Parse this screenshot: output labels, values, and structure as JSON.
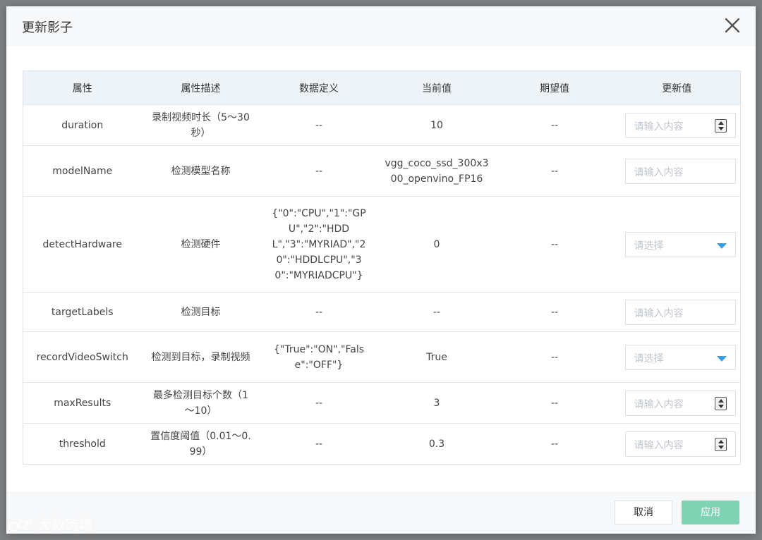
{
  "dialog": {
    "title": "更新影子",
    "cancel_label": "取消",
    "apply_label": "应用"
  },
  "table": {
    "headers": [
      "属性",
      "属性描述",
      "数据定义",
      "当前值",
      "期望值",
      "更新值"
    ],
    "rows": [
      {
        "name": "duration",
        "desc": "录制视频时长（5～30秒）",
        "def": "--",
        "current": "10",
        "expected": "--",
        "placeholder": "请输入内容",
        "control": "number"
      },
      {
        "name": "modelName",
        "desc": "检测模型名称",
        "def": "--",
        "current": "vgg_coco_ssd_300x300_openvino_FP16",
        "expected": "--",
        "placeholder": "请输入内容",
        "control": "text"
      },
      {
        "name": "detectHardware",
        "desc": "检测硬件",
        "def": "{\"0\":\"CPU\",\"1\":\"GPU\",\"2\":\"HDDL\",\"3\":\"MYRIAD\",\"20\":\"HDDLCPU\",\"30\":\"MYRIADCPU\"}",
        "current": "0",
        "expected": "--",
        "placeholder": "请选择",
        "control": "select"
      },
      {
        "name": "targetLabels",
        "desc": "检测目标",
        "def": "--",
        "current": "--",
        "expected": "--",
        "placeholder": "请输入内容",
        "control": "text"
      },
      {
        "name": "recordVideoSwitch",
        "desc": "检测到目标，录制视频",
        "def": "{\"True\":\"ON\",\"False\":\"OFF\"}",
        "current": "True",
        "expected": "--",
        "placeholder": "请选择",
        "control": "select"
      },
      {
        "name": "maxResults",
        "desc": "最多检测目标个数（1～10）",
        "def": "--",
        "current": "3",
        "expected": "--",
        "placeholder": "请输入内容",
        "control": "number"
      },
      {
        "name": "threshold",
        "desc": "置信度阈值（0.01～0.99）",
        "def": "--",
        "current": "0.3",
        "expected": "--",
        "placeholder": "请输入内容",
        "control": "number"
      }
    ]
  },
  "watermark": "大数跨境",
  "colors": {
    "header_bg": "#eef3f8",
    "apply_btn": "#7fd3b5",
    "caret": "#3d9ce8",
    "overlay": "#7d7f82"
  },
  "icons": {
    "close": "close-icon",
    "stepper": "stepper-icon",
    "dropdown": "chevron-down-icon",
    "watermark_logo": "watermark-logo-icon"
  }
}
